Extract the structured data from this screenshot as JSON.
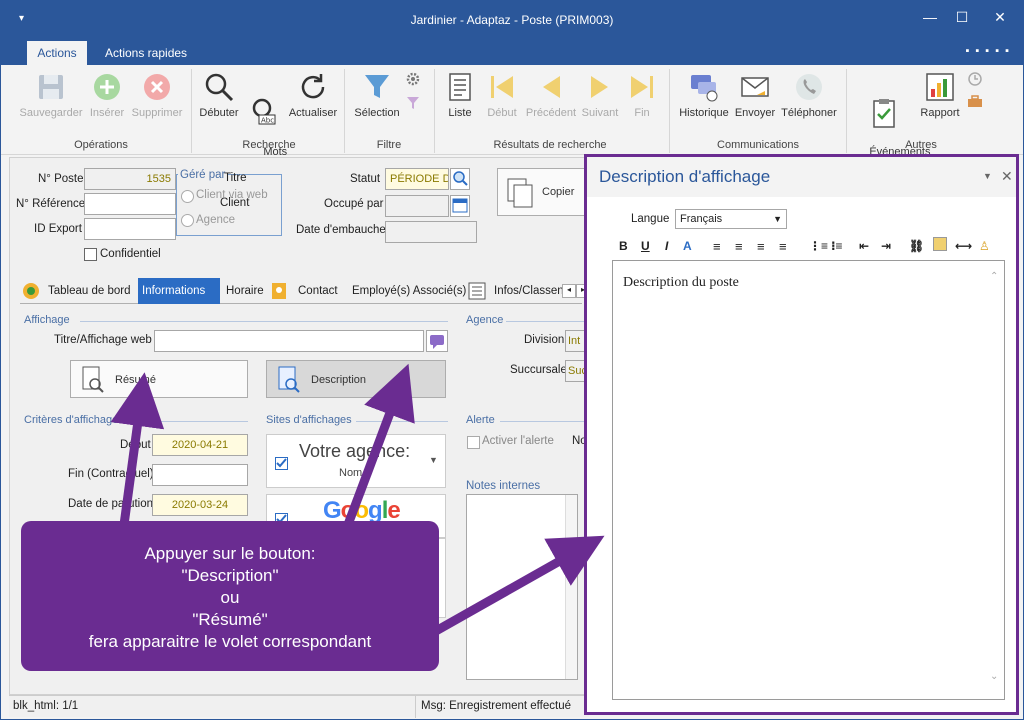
{
  "window": {
    "title": "Jardinier - Adaptaz - Poste (PRIM003)",
    "minimize": "—",
    "maximize": "☐",
    "close": "✕",
    "qat": "▾"
  },
  "tabs": {
    "actions": "Actions",
    "quick_actions": "Actions rapides"
  },
  "ribbon": {
    "save": "Sauvegarder",
    "insert": "Insérer",
    "delete": "Supprimer",
    "group_operations": "Opérations",
    "start": "Débuter",
    "keywords": "Mots\nclés ▾",
    "refresh": "Actualiser",
    "group_search": "Recherche",
    "selection": "Sélection",
    "group_filter": "Filtre",
    "list": "Liste",
    "first": "Début",
    "previous": "Précédent",
    "next": "Suivant",
    "last": "Fin",
    "group_results": "Résultats de recherche",
    "history": "Historique",
    "send": "Envoyer",
    "phone": "Téléphoner",
    "group_comm": "Communications",
    "events": "Événements\net tâches",
    "report": "Rapport",
    "group_other": "Autres"
  },
  "form": {
    "poste_label": "N° Poste",
    "poste_value": "1535",
    "reference_label": "N° Référence",
    "reference_value": "",
    "export_label": "ID Export",
    "export_value": "",
    "confidential_label": "Confidentiel",
    "managed_by_label": "Géré par",
    "client_web": "Client via web",
    "client": "Client",
    "agency": "Agence",
    "title_label": "Titre",
    "status_label": "Statut",
    "status_value": "PÉRIODE D'",
    "occupied_label": "Occupé par",
    "hire_label": "Date d'embauche",
    "copy_button": "Copier"
  },
  "form_tabs": [
    "Tableau de bord",
    "Informations",
    "Horaire",
    "Contact",
    "Employé(s) Associé(s)",
    "Infos/Classen"
  ],
  "display": {
    "section": "Affichage",
    "web_title_label": "Titre/Affichage web",
    "web_title_value": "",
    "summary_button": "Résumé",
    "description_button": "Description",
    "criteria_section": "Critères d'affichage",
    "start_label": "Début",
    "start_value": "2020-04-21",
    "end_label": "Fin (Contractuel)",
    "end_value": "",
    "pub_label": "Date de parution",
    "pub_value": "2020-03-24",
    "sites_section": "Sites d'affichages",
    "site1": "Votre agence:",
    "site1_sub": "Nom",
    "agency_section": "Agence",
    "division_label": "Division",
    "division_value": "Int",
    "branch_label": "Succursale",
    "branch_value": "Suc",
    "alert_section": "Alerte",
    "alert_label": "Activer l'alerte",
    "alert_no": "No",
    "notes_label": "Notes internes"
  },
  "statusbar": {
    "left": "blk_html: 1/1",
    "right": "Msg: Enregistrement effectué"
  },
  "panel": {
    "title": "Description d'affichage",
    "lang_label": "Langue",
    "lang_value": "Français",
    "content": "Description du poste"
  },
  "callout": {
    "line1": "Appuyer sur le bouton:",
    "line2": "\"Description\"",
    "line3": "ou",
    "line4": "\"Résumé\"",
    "line5": "fera apparaitre le volet correspondant"
  },
  "colors": {
    "brand": "#2b579a",
    "callout": "#6a2c91",
    "active_tab": "#2b6cc4"
  }
}
